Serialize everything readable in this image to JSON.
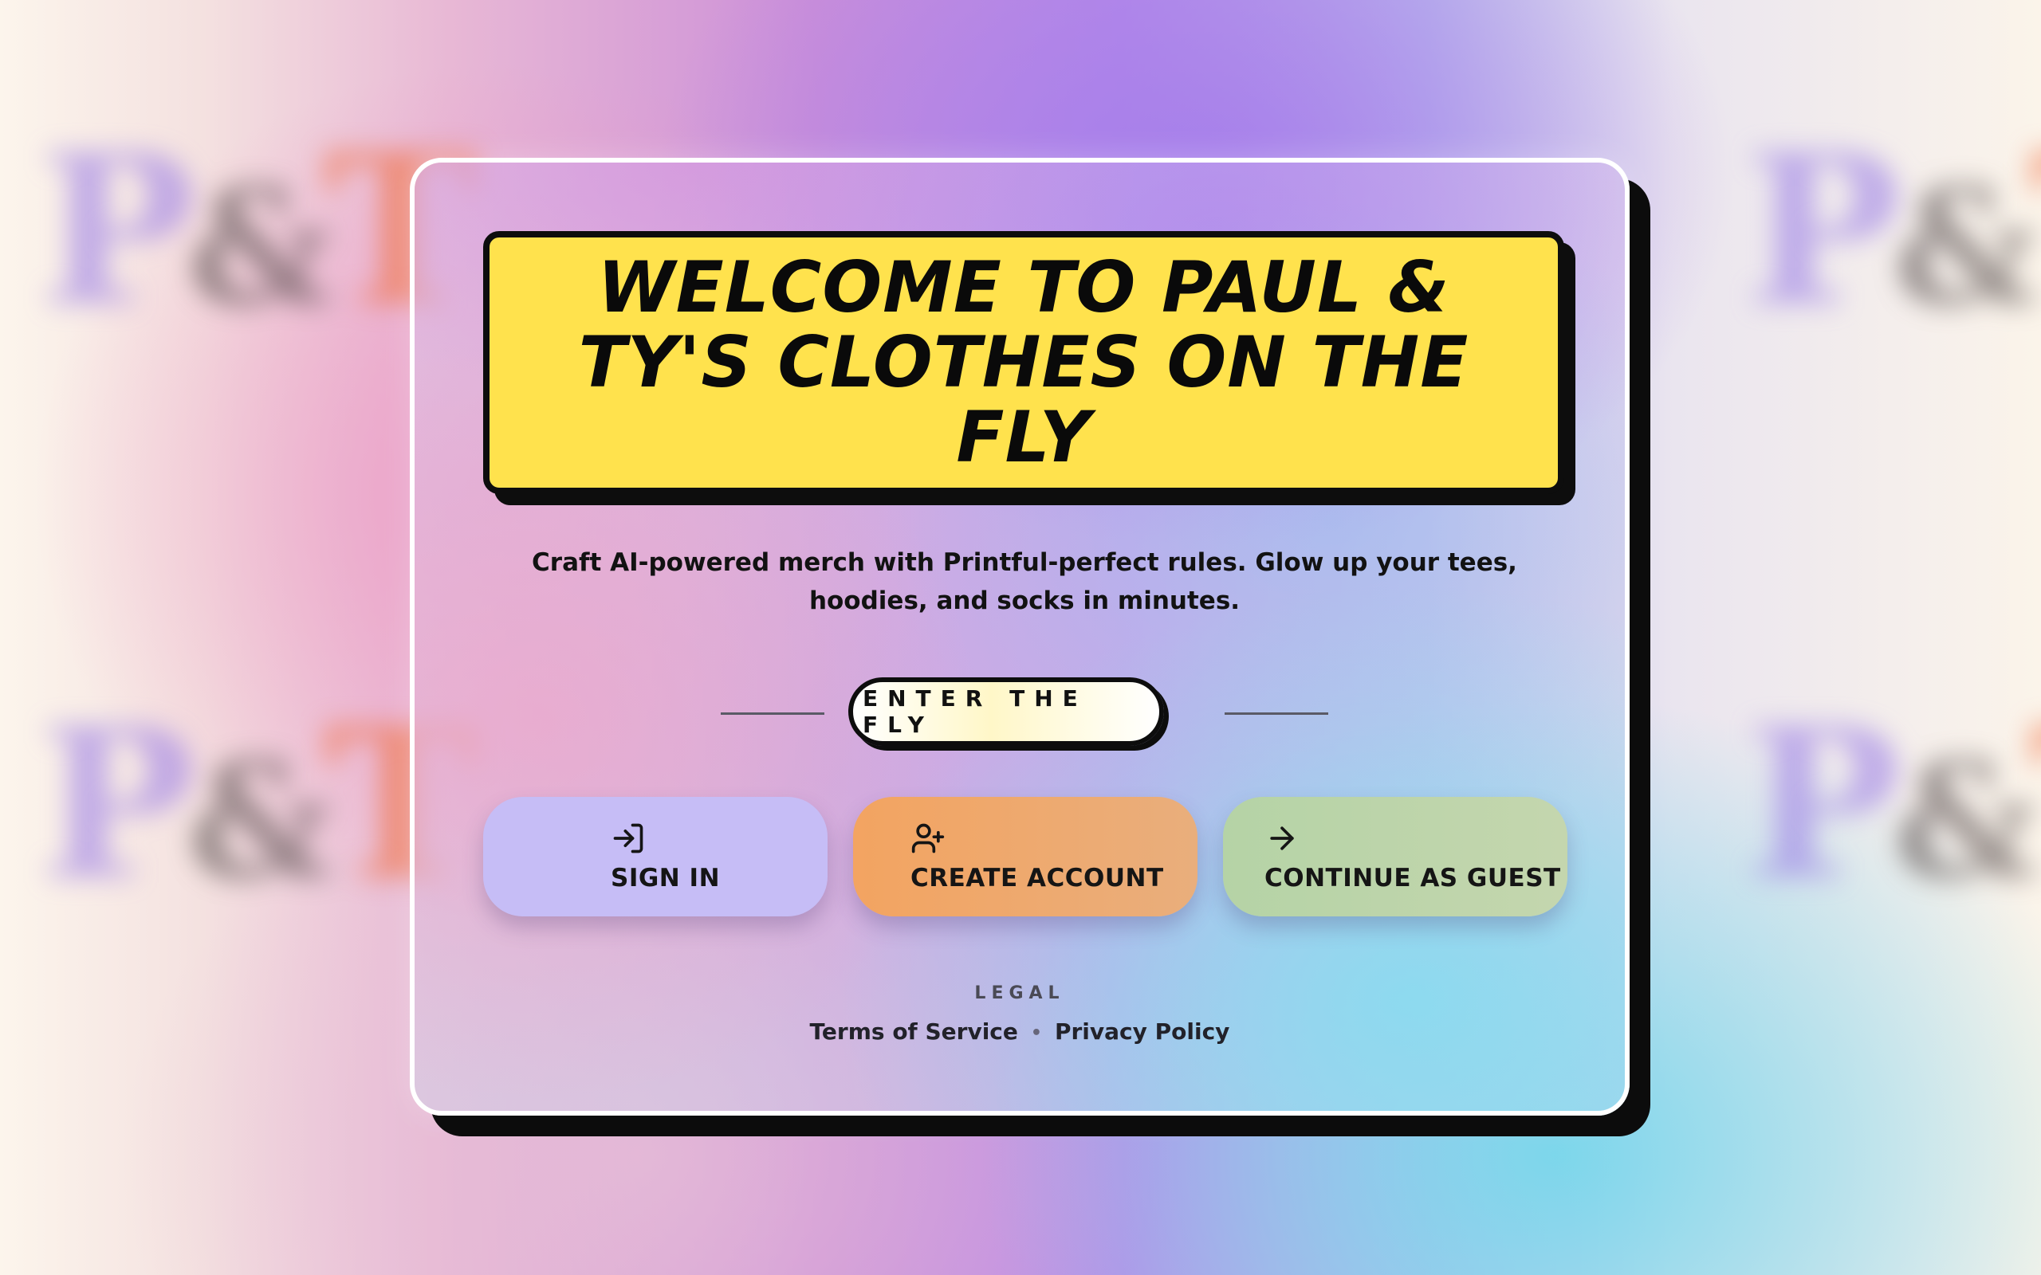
{
  "background": {
    "logo_marks": [
      {
        "p": "P",
        "amp": "&",
        "t": "T"
      },
      {
        "p": "P",
        "amp": "&",
        "t": "T"
      },
      {
        "p": "P",
        "amp": "&",
        "t": "T"
      },
      {
        "p": "P",
        "amp": "&",
        "t": "T"
      }
    ]
  },
  "hero": {
    "title": "WELCOME TO PAUL & TY'S CLOTHES ON THE FLY",
    "subtitle": "Craft AI-powered merch with Printful-perfect rules. Glow up your tees, hoodies, and socks in minutes."
  },
  "cta": {
    "enter_label": "ENTER THE FLY"
  },
  "actions": {
    "sign_in": {
      "label": "SIGN IN",
      "icon": "sign-in-icon"
    },
    "create_account": {
      "label": "CREATE ACCOUNT",
      "icon": "user-plus-icon"
    },
    "guest": {
      "label": "CONTINUE AS GUEST",
      "icon": "arrow-right-icon"
    }
  },
  "legal": {
    "heading": "LEGAL",
    "terms": "Terms of Service",
    "separator": "•",
    "privacy": "Privacy Policy"
  },
  "colors": {
    "title_bg": "#ffe24d",
    "sign_in_bg": "#c6bdf6",
    "create_account_bg": "#f3a461",
    "guest_bg": "#b5d3a6",
    "outline": "#0d0d0d"
  }
}
